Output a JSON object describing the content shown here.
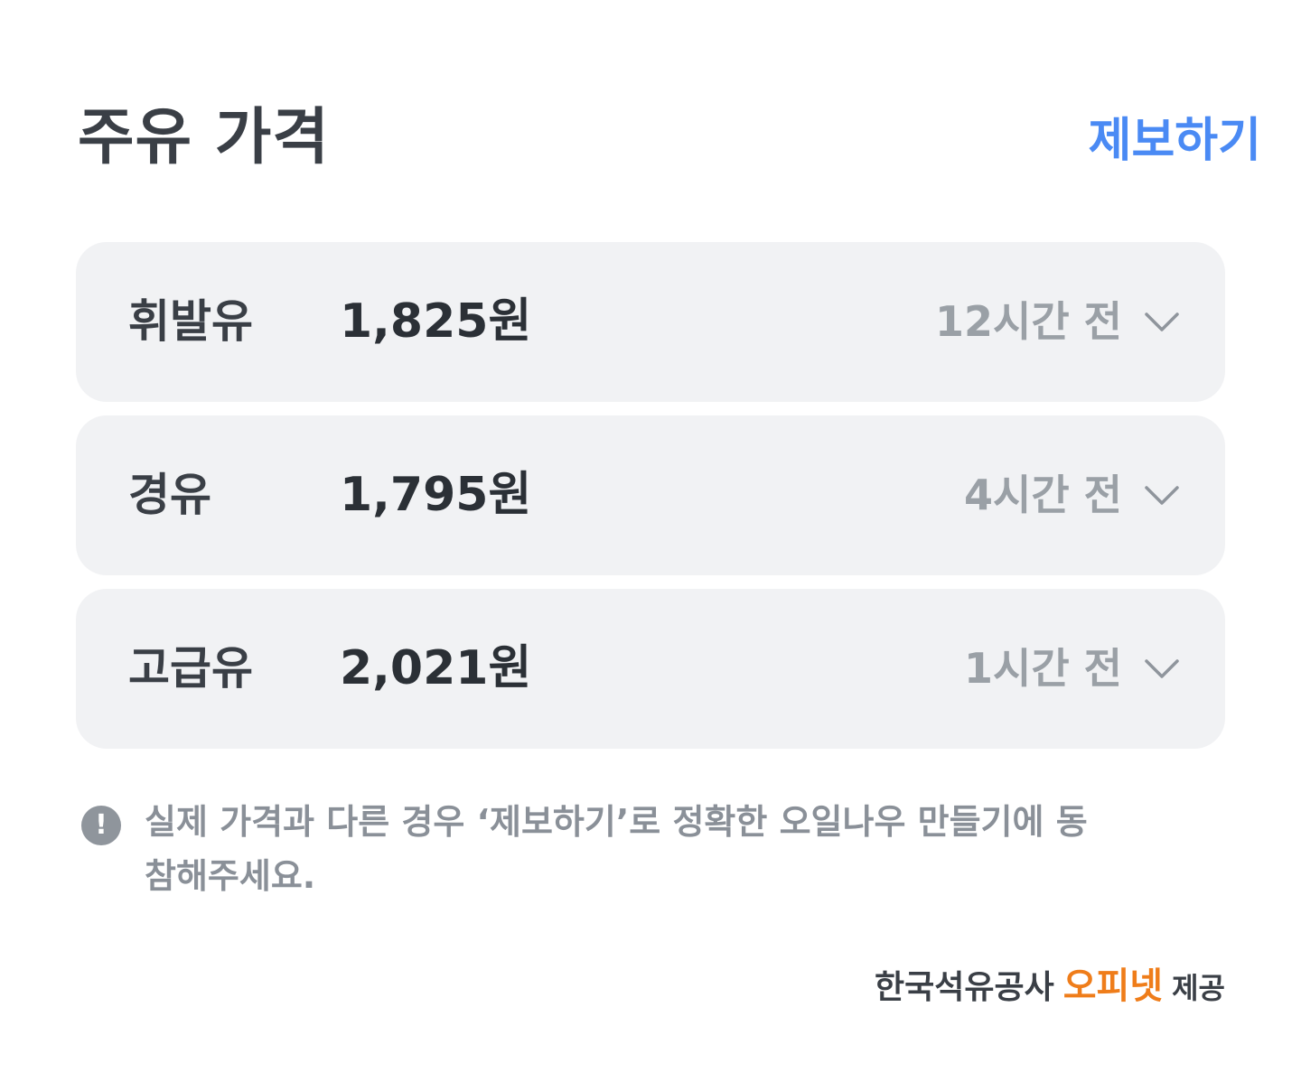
{
  "header": {
    "title": "주유 가격",
    "report_label": "제보하기"
  },
  "fuels": [
    {
      "name": "휘발유",
      "price": "1,825원",
      "updated": "12시간 전"
    },
    {
      "name": "경유",
      "price": "1,795원",
      "updated": "4시간 전"
    },
    {
      "name": "고급유",
      "price": "2,021원",
      "updated": "1시간 전"
    }
  ],
  "notice": {
    "icon": "exclamation-circle-icon",
    "text": "실제 가격과 다른 경우 ‘제보하기’로 정확한 오일나우 만들기에 동참해주세요."
  },
  "provider": {
    "org": "한국석유공사",
    "brand": "오피넷",
    "suffix": "제공"
  },
  "colors": {
    "accent": "#4a8af4",
    "brand": "#ef7d1a",
    "row_bg": "#f1f2f4"
  }
}
